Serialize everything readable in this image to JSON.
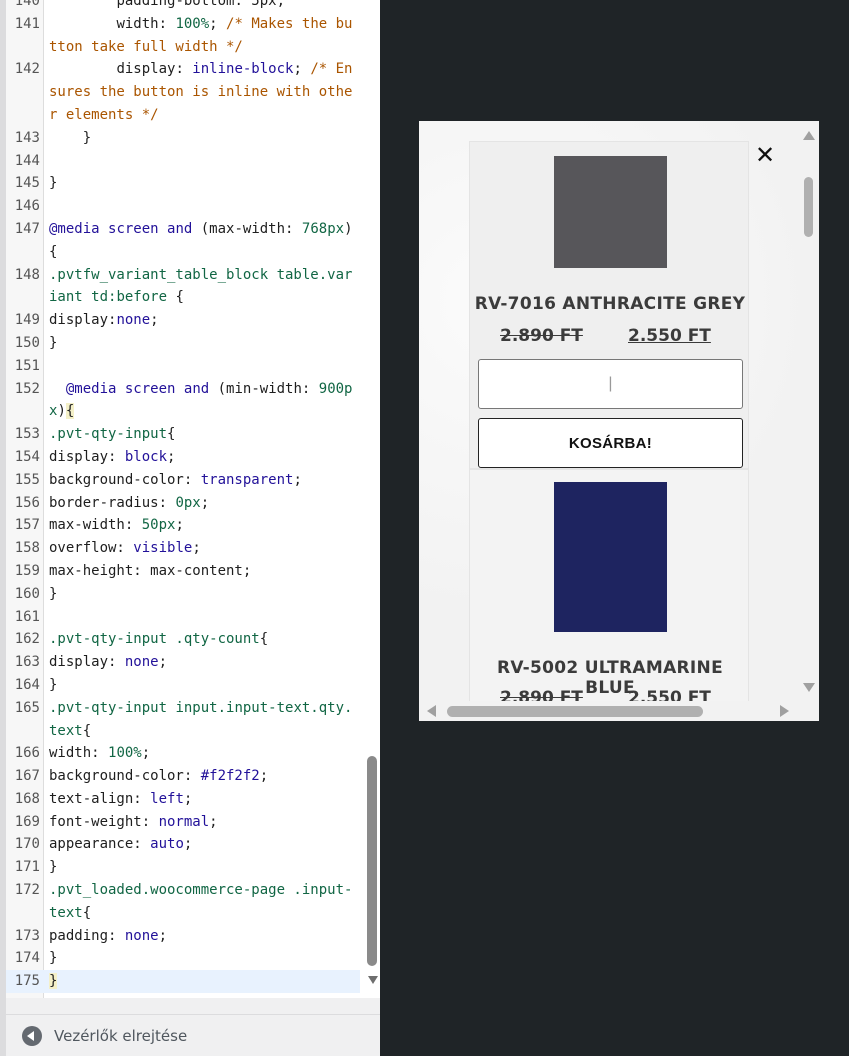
{
  "editor": {
    "lines": [
      {
        "n": "140",
        "parts": [
          {
            "t": "        padding-bottom: 5px;",
            "c": "prop"
          }
        ]
      },
      {
        "n": "141",
        "parts": [
          {
            "t": "        width: ",
            "c": "prop"
          },
          {
            "t": "100%",
            "c": "val-num"
          },
          {
            "t": "; ",
            "c": "prop"
          },
          {
            "t": "/* Makes the button take full width */",
            "c": "cmt"
          }
        ]
      },
      {
        "n": "142",
        "parts": [
          {
            "t": "        display: ",
            "c": "prop"
          },
          {
            "t": "inline-block",
            "c": "val-kw"
          },
          {
            "t": "; ",
            "c": "prop"
          },
          {
            "t": "/* Ensures the button is inline with other elements */",
            "c": "cmt"
          }
        ]
      },
      {
        "n": "143",
        "parts": [
          {
            "t": "    }",
            "c": "prop"
          }
        ]
      },
      {
        "n": "144",
        "parts": [
          {
            "t": "",
            "c": "prop"
          }
        ]
      },
      {
        "n": "145",
        "parts": [
          {
            "t": "}",
            "c": "prop"
          }
        ]
      },
      {
        "n": "146",
        "parts": [
          {
            "t": "",
            "c": "prop"
          }
        ]
      },
      {
        "n": "147",
        "parts": [
          {
            "t": "@media",
            "c": "at"
          },
          {
            "t": " ",
            "c": "prop"
          },
          {
            "t": "screen",
            "c": "at"
          },
          {
            "t": " ",
            "c": "prop"
          },
          {
            "t": "and",
            "c": "at"
          },
          {
            "t": " (max-width: ",
            "c": "prop"
          },
          {
            "t": "768px",
            "c": "val-num"
          },
          {
            "t": ") {",
            "c": "prop"
          }
        ]
      },
      {
        "n": "148",
        "parts": [
          {
            "t": ".pvtfw_variant_table_block ",
            "c": "sel"
          },
          {
            "t": "table",
            "c": "sel"
          },
          {
            "t": ".variant ",
            "c": "sel"
          },
          {
            "t": "td",
            "c": "sel"
          },
          {
            "t": ":before",
            "c": "sel"
          },
          {
            "t": " {",
            "c": "prop"
          }
        ]
      },
      {
        "n": "149",
        "parts": [
          {
            "t": "display:",
            "c": "prop"
          },
          {
            "t": "none",
            "c": "val-kw"
          },
          {
            "t": ";",
            "c": "prop"
          }
        ]
      },
      {
        "n": "150",
        "parts": [
          {
            "t": "}",
            "c": "prop"
          }
        ]
      },
      {
        "n": "151",
        "parts": [
          {
            "t": "",
            "c": "prop"
          }
        ]
      },
      {
        "n": "152",
        "parts": [
          {
            "t": "  ",
            "c": "prop"
          },
          {
            "t": "@media",
            "c": "at"
          },
          {
            "t": " ",
            "c": "prop"
          },
          {
            "t": "screen",
            "c": "at"
          },
          {
            "t": " ",
            "c": "prop"
          },
          {
            "t": "and",
            "c": "at"
          },
          {
            "t": " (min-width: ",
            "c": "prop"
          },
          {
            "t": "900px",
            "c": "val-num"
          },
          {
            "t": ")",
            "c": "prop"
          },
          {
            "t": "{",
            "c": "bracket"
          }
        ]
      },
      {
        "n": "153",
        "parts": [
          {
            "t": ".pvt-qty-input",
            "c": "sel"
          },
          {
            "t": "{",
            "c": "prop"
          }
        ]
      },
      {
        "n": "154",
        "parts": [
          {
            "t": "display: ",
            "c": "prop"
          },
          {
            "t": "block",
            "c": "val-kw"
          },
          {
            "t": ";",
            "c": "prop"
          }
        ]
      },
      {
        "n": "155",
        "parts": [
          {
            "t": "background-color: ",
            "c": "prop"
          },
          {
            "t": "transparent",
            "c": "val-kw"
          },
          {
            "t": ";",
            "c": "prop"
          }
        ]
      },
      {
        "n": "156",
        "parts": [
          {
            "t": "border-radius: ",
            "c": "prop"
          },
          {
            "t": "0px",
            "c": "val-num"
          },
          {
            "t": ";",
            "c": "prop"
          }
        ]
      },
      {
        "n": "157",
        "parts": [
          {
            "t": "max-width: ",
            "c": "prop"
          },
          {
            "t": "50px",
            "c": "val-num"
          },
          {
            "t": ";",
            "c": "prop"
          }
        ]
      },
      {
        "n": "158",
        "parts": [
          {
            "t": "overflow: ",
            "c": "prop"
          },
          {
            "t": "visible",
            "c": "val-kw"
          },
          {
            "t": ";",
            "c": "prop"
          }
        ]
      },
      {
        "n": "159",
        "parts": [
          {
            "t": "max-height: max-content;",
            "c": "prop"
          }
        ]
      },
      {
        "n": "160",
        "parts": [
          {
            "t": "}",
            "c": "prop"
          }
        ]
      },
      {
        "n": "161",
        "parts": [
          {
            "t": "",
            "c": "prop"
          }
        ]
      },
      {
        "n": "162",
        "parts": [
          {
            "t": ".pvt-qty-input .qty-count",
            "c": "sel"
          },
          {
            "t": "{",
            "c": "prop"
          }
        ]
      },
      {
        "n": "163",
        "parts": [
          {
            "t": "display: ",
            "c": "prop"
          },
          {
            "t": "none",
            "c": "val-kw"
          },
          {
            "t": ";",
            "c": "prop"
          }
        ]
      },
      {
        "n": "164",
        "parts": [
          {
            "t": "}",
            "c": "prop"
          }
        ]
      },
      {
        "n": "165",
        "parts": [
          {
            "t": ".pvt-qty-input ",
            "c": "sel"
          },
          {
            "t": "input",
            "c": "sel"
          },
          {
            "t": ".input-text.qty.text",
            "c": "sel"
          },
          {
            "t": "{",
            "c": "prop"
          }
        ]
      },
      {
        "n": "166",
        "parts": [
          {
            "t": "width: ",
            "c": "prop"
          },
          {
            "t": "100%",
            "c": "val-num"
          },
          {
            "t": ";",
            "c": "prop"
          }
        ]
      },
      {
        "n": "167",
        "parts": [
          {
            "t": "background-color: ",
            "c": "prop"
          },
          {
            "t": "#f2f2f2",
            "c": "val-kw"
          },
          {
            "t": ";",
            "c": "prop"
          }
        ]
      },
      {
        "n": "168",
        "parts": [
          {
            "t": "text-align: ",
            "c": "prop"
          },
          {
            "t": "left",
            "c": "val-kw"
          },
          {
            "t": ";",
            "c": "prop"
          }
        ]
      },
      {
        "n": "169",
        "parts": [
          {
            "t": "font-weight: ",
            "c": "prop"
          },
          {
            "t": "normal",
            "c": "val-kw"
          },
          {
            "t": ";",
            "c": "prop"
          }
        ]
      },
      {
        "n": "170",
        "parts": [
          {
            "t": "appearance: ",
            "c": "prop"
          },
          {
            "t": "auto",
            "c": "val-kw"
          },
          {
            "t": ";",
            "c": "prop"
          }
        ]
      },
      {
        "n": "171",
        "parts": [
          {
            "t": "}",
            "c": "prop"
          }
        ]
      },
      {
        "n": "172",
        "parts": [
          {
            "t": ".pvt_loaded.woocommerce-page .input-text",
            "c": "sel"
          },
          {
            "t": "{",
            "c": "prop"
          }
        ]
      },
      {
        "n": "173",
        "parts": [
          {
            "t": "padding: ",
            "c": "prop"
          },
          {
            "t": "none",
            "c": "val-kw"
          },
          {
            "t": ";",
            "c": "prop"
          }
        ]
      },
      {
        "n": "174",
        "parts": [
          {
            "t": "}",
            "c": "prop"
          }
        ]
      },
      {
        "n": "175",
        "parts": [
          {
            "t": "}",
            "c": "bracket"
          }
        ],
        "active": true
      }
    ]
  },
  "footer": {
    "collapse_label": "Vezérlők elrejtése",
    "icon": "collapse-arrow-icon"
  },
  "preview": {
    "close_icon": "close-icon",
    "close_glyph": "✕",
    "products": [
      {
        "name": "RV-7016 ANTHRACITE GREY",
        "old_price": "2.890 FT",
        "new_price": "2.550 FT",
        "swatch_color": "#57565a"
      },
      {
        "name": "RV-5002 ULTRAMARINE BLUE",
        "old_price": "2.890 FT",
        "new_price": "2.550 FT",
        "swatch_color": "#1e2460"
      }
    ],
    "qty_value": "|",
    "cart_button_label": "KOSÁRBA!"
  }
}
